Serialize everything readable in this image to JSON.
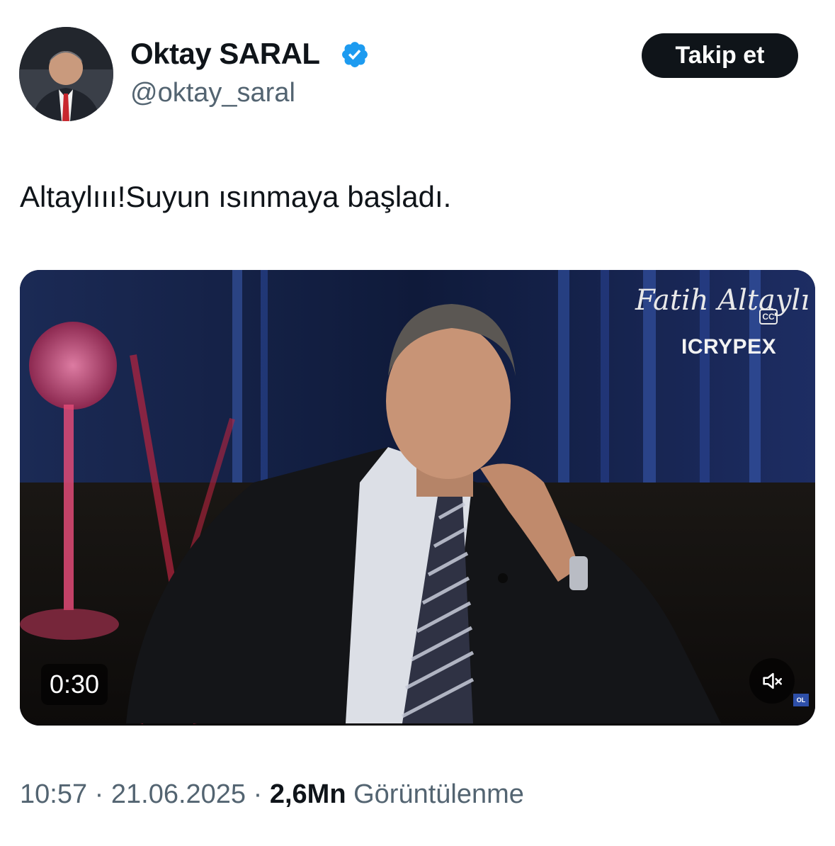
{
  "author": {
    "display_name": "Oktay SARAL",
    "handle": "@oktay_saral",
    "verified": true,
    "verified_color": "#1d9bf0"
  },
  "follow_button": {
    "label": "Takip et"
  },
  "tweet": {
    "text": "Altaylııı!Suyun ısınmaya başladı."
  },
  "media": {
    "type": "video",
    "watermark_name": "Fatih Altaylı",
    "cc_label": "CC",
    "sponsor_logo": "ICRYPEX",
    "duration": "0:30",
    "mute_icon": "speaker-muted-icon",
    "corner_logo": "OL"
  },
  "meta": {
    "time": "10:57",
    "separator": " · ",
    "date": "21.06.2025",
    "views_count": "2,6Mn",
    "views_label": "Görüntülenme"
  },
  "colors": {
    "text_primary": "#0f1419",
    "text_secondary": "#536471",
    "button_bg": "#0f1419"
  }
}
